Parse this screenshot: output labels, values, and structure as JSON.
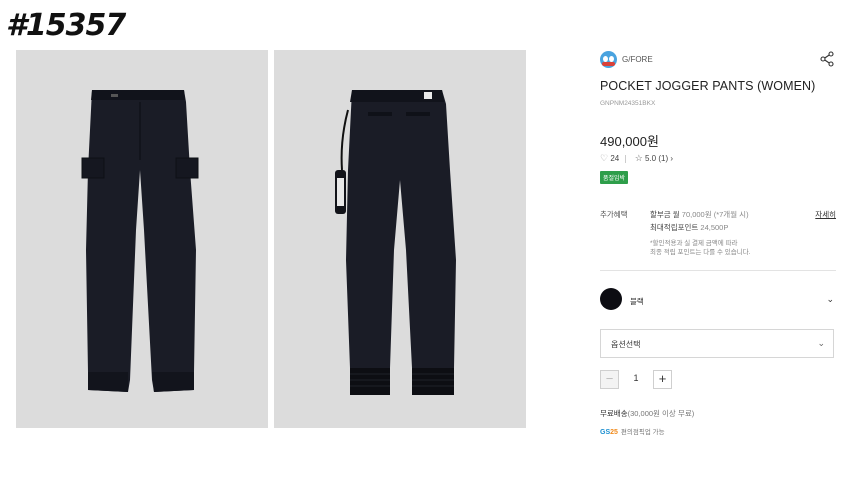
{
  "overlay_tag": "#15357",
  "product": {
    "brand": "G/FORE",
    "title": "POCKET JOGGER PANTS (WOMEN)",
    "code": "GNPNM24351BKX",
    "price": "490,000원",
    "likes": "24",
    "rating": "5.0",
    "reviews": "(1)",
    "badge": "품절임박",
    "share_icon": "share-icon"
  },
  "benefits": {
    "label": "추가혜택",
    "installment": "할부금 월",
    "installment_value": "70,000원 (*7개월 시)",
    "points_label": "최대적립포인트",
    "points_value": "24,500P",
    "detail_link": "자세히",
    "note_line1": "*할인적용과 실 결제 금액에 따라",
    "note_line2": "최종 적립 포인트는 다를 수 있습니다."
  },
  "color_option": {
    "name": "블랙",
    "swatch_color": "#0c0c12"
  },
  "option_select": {
    "placeholder": "옵션선택"
  },
  "quantity": {
    "value": "1",
    "minus": "−",
    "plus": "+"
  },
  "shipping": {
    "free": "무료배송",
    "condition": "(30,000원 이상 무료)",
    "pickup_brand_gs": "GS",
    "pickup_brand_num": "25",
    "pickup_text": "편의점픽업 가능"
  }
}
